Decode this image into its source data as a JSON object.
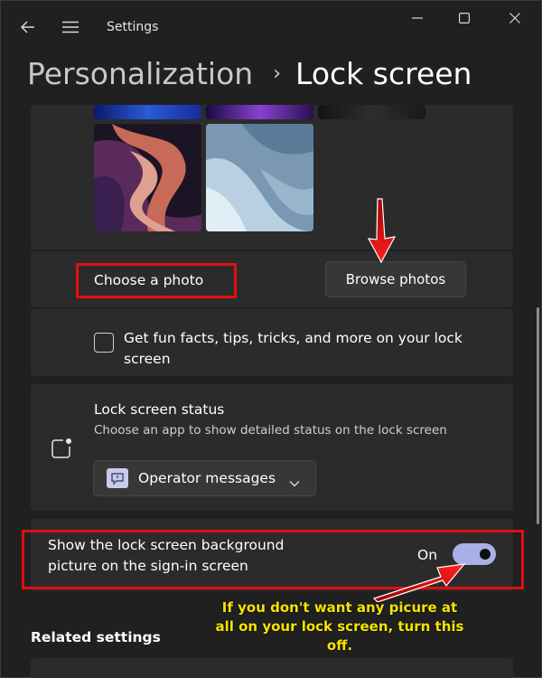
{
  "window": {
    "title": "Settings"
  },
  "header": {
    "crumb": "Personalization",
    "separator": "›",
    "current": "Lock screen"
  },
  "photo_section": {
    "choose_label": "Choose a photo",
    "browse_button": "Browse photos"
  },
  "fun_facts": {
    "label": "Get fun facts, tips, tricks, and more on your lock screen",
    "checked": false
  },
  "status": {
    "title": "Lock screen status",
    "subtitle": "Choose an app to show detailed status on the lock screen",
    "dropdown_value": "Operator messages"
  },
  "signin": {
    "label": "Show the lock screen background picture on the sign-in screen",
    "toggle_state": "On",
    "enabled": true
  },
  "annotation": {
    "text": "If you don't want any picure at all on your lock screen, turn this off."
  },
  "related": {
    "title": "Related settings"
  },
  "colors": {
    "accent": "#aab0e6",
    "annotation_red": "#e01010",
    "annotation_yellow": "#f5e400"
  }
}
